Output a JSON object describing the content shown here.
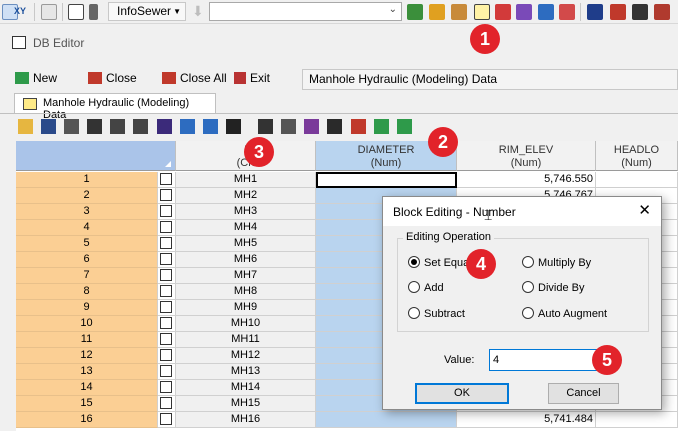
{
  "toolbar": {
    "xy_label": "XY",
    "module_label": "InfoSewer",
    "combo_value": ""
  },
  "window": {
    "title": "DB Editor"
  },
  "actions": {
    "new_label": "New",
    "close_label": "Close",
    "close_all_label": "Close All",
    "exit_label": "Exit",
    "table_selector": "Manhole Hydraulic (Modeling) Data"
  },
  "tab": {
    "label": "Manhole Hydraulic (Modeling) Data"
  },
  "grid": {
    "columns": [
      {
        "label": "",
        "type": ""
      },
      {
        "label": "",
        "type": ""
      },
      {
        "label": "I",
        "type": "(Ch"
      },
      {
        "label": "DIAMETER",
        "type": "(Num)"
      },
      {
        "label": "RIM_ELEV",
        "type": "(Num)"
      },
      {
        "label": "HEADLO",
        "type": "(Num)"
      }
    ],
    "rows": [
      {
        "num": "1",
        "id": "MH1",
        "rim": "5,746.550"
      },
      {
        "num": "2",
        "id": "MH2",
        "rim": "5,746.767"
      },
      {
        "num": "3",
        "id": "MH3",
        "rim": ""
      },
      {
        "num": "4",
        "id": "MH4",
        "rim": ""
      },
      {
        "num": "5",
        "id": "MH5",
        "rim": ""
      },
      {
        "num": "6",
        "id": "MH6",
        "rim": ""
      },
      {
        "num": "7",
        "id": "MH7",
        "rim": ""
      },
      {
        "num": "8",
        "id": "MH8",
        "rim": ""
      },
      {
        "num": "9",
        "id": "MH9",
        "rim": ""
      },
      {
        "num": "10",
        "id": "MH10",
        "rim": ""
      },
      {
        "num": "11",
        "id": "MH11",
        "rim": ""
      },
      {
        "num": "12",
        "id": "MH12",
        "rim": ""
      },
      {
        "num": "13",
        "id": "MH13",
        "rim": ""
      },
      {
        "num": "14",
        "id": "MH14",
        "rim": ""
      },
      {
        "num": "15",
        "id": "MH15",
        "rim": ""
      },
      {
        "num": "16",
        "id": "MH16",
        "rim": "5,741.484"
      }
    ]
  },
  "dialog": {
    "title": "Block Editing - Number",
    "group_label": "Editing Operation",
    "options": {
      "set_equal": "Set Equal",
      "add": "Add",
      "subtract": "Subtract",
      "multiply_by": "Multiply By",
      "divide_by": "Divide By",
      "auto_augment": "Auto Augment"
    },
    "selected_option": "set_equal",
    "value_label": "Value:",
    "value": "4",
    "ok_label": "OK",
    "cancel_label": "Cancel"
  },
  "callouts": [
    "1",
    "2",
    "3",
    "4",
    "5"
  ],
  "colors": {
    "row_header": "#fbcf94",
    "selected_column": "#b9d4ef",
    "callout": "#e2232a",
    "focus": "#0078d7"
  }
}
